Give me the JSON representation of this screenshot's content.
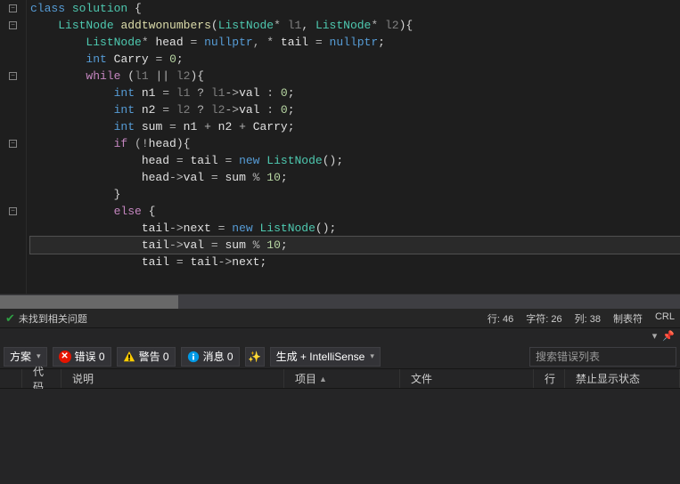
{
  "code": {
    "lines": [
      {
        "fold": "-",
        "segs": [
          {
            "t": "class ",
            "c": "kw"
          },
          {
            "t": "solution",
            "c": "type"
          },
          {
            "t": " {",
            "c": "punct"
          }
        ]
      },
      {
        "fold": "-",
        "segs": [
          {
            "t": "    ",
            "c": ""
          },
          {
            "t": "ListNode",
            "c": "type"
          },
          {
            "t": " ",
            "c": ""
          },
          {
            "t": "addtwonumbers",
            "c": "fn"
          },
          {
            "t": "(",
            "c": "punct"
          },
          {
            "t": "ListNode",
            "c": "type"
          },
          {
            "t": "* ",
            "c": "op"
          },
          {
            "t": "l1",
            "c": "param"
          },
          {
            "t": ", ",
            "c": "punct"
          },
          {
            "t": "ListNode",
            "c": "type"
          },
          {
            "t": "* ",
            "c": "op"
          },
          {
            "t": "l2",
            "c": "param"
          },
          {
            "t": "){",
            "c": "punct"
          }
        ]
      },
      {
        "fold": "",
        "segs": [
          {
            "t": "        ",
            "c": ""
          },
          {
            "t": "ListNode",
            "c": "type"
          },
          {
            "t": "* ",
            "c": "op"
          },
          {
            "t": "head",
            "c": "var"
          },
          {
            "t": " = ",
            "c": "op"
          },
          {
            "t": "nullptr",
            "c": "np"
          },
          {
            "t": ", * ",
            "c": "op"
          },
          {
            "t": "tail",
            "c": "var"
          },
          {
            "t": " = ",
            "c": "op"
          },
          {
            "t": "nullptr",
            "c": "np"
          },
          {
            "t": ";",
            "c": "punct"
          }
        ]
      },
      {
        "fold": "",
        "segs": [
          {
            "t": "        ",
            "c": ""
          },
          {
            "t": "int",
            "c": "kw"
          },
          {
            "t": " ",
            "c": ""
          },
          {
            "t": "Carry",
            "c": "var"
          },
          {
            "t": " = ",
            "c": "op"
          },
          {
            "t": "0",
            "c": "num"
          },
          {
            "t": ";",
            "c": "punct"
          }
        ]
      },
      {
        "fold": "-",
        "segs": [
          {
            "t": "        ",
            "c": ""
          },
          {
            "t": "while",
            "c": "newk"
          },
          {
            "t": " (",
            "c": "punct"
          },
          {
            "t": "l1",
            "c": "param"
          },
          {
            "t": " || ",
            "c": "op"
          },
          {
            "t": "l2",
            "c": "param"
          },
          {
            "t": "){",
            "c": "punct"
          }
        ]
      },
      {
        "fold": "",
        "segs": [
          {
            "t": "            ",
            "c": ""
          },
          {
            "t": "int",
            "c": "kw"
          },
          {
            "t": " ",
            "c": ""
          },
          {
            "t": "n1",
            "c": "var"
          },
          {
            "t": " = ",
            "c": "op"
          },
          {
            "t": "l1",
            "c": "param"
          },
          {
            "t": " ? ",
            "c": "op"
          },
          {
            "t": "l1",
            "c": "param"
          },
          {
            "t": "->",
            "c": "op"
          },
          {
            "t": "val",
            "c": "var"
          },
          {
            "t": " : ",
            "c": "op"
          },
          {
            "t": "0",
            "c": "num"
          },
          {
            "t": ";",
            "c": "punct"
          }
        ]
      },
      {
        "fold": "",
        "segs": [
          {
            "t": "            ",
            "c": ""
          },
          {
            "t": "int",
            "c": "kw"
          },
          {
            "t": " ",
            "c": ""
          },
          {
            "t": "n2",
            "c": "var"
          },
          {
            "t": " = ",
            "c": "op"
          },
          {
            "t": "l2",
            "c": "param"
          },
          {
            "t": " ? ",
            "c": "op"
          },
          {
            "t": "l2",
            "c": "param"
          },
          {
            "t": "->",
            "c": "op"
          },
          {
            "t": "val",
            "c": "var"
          },
          {
            "t": " : ",
            "c": "op"
          },
          {
            "t": "0",
            "c": "num"
          },
          {
            "t": ";",
            "c": "punct"
          }
        ]
      },
      {
        "fold": "",
        "segs": [
          {
            "t": "            ",
            "c": ""
          },
          {
            "t": "int",
            "c": "kw"
          },
          {
            "t": " ",
            "c": ""
          },
          {
            "t": "sum",
            "c": "var"
          },
          {
            "t": " = ",
            "c": "op"
          },
          {
            "t": "n1",
            "c": "var"
          },
          {
            "t": " + ",
            "c": "op"
          },
          {
            "t": "n2",
            "c": "var"
          },
          {
            "t": " + ",
            "c": "op"
          },
          {
            "t": "Carry",
            "c": "var"
          },
          {
            "t": ";",
            "c": "punct"
          }
        ]
      },
      {
        "fold": "-",
        "segs": [
          {
            "t": "            ",
            "c": ""
          },
          {
            "t": "if",
            "c": "newk"
          },
          {
            "t": " (!",
            "c": "op"
          },
          {
            "t": "head",
            "c": "var"
          },
          {
            "t": "){",
            "c": "punct"
          }
        ]
      },
      {
        "fold": "",
        "segs": [
          {
            "t": "                ",
            "c": ""
          },
          {
            "t": "head",
            "c": "var"
          },
          {
            "t": " = ",
            "c": "op"
          },
          {
            "t": "tail",
            "c": "var"
          },
          {
            "t": " = ",
            "c": "op"
          },
          {
            "t": "new",
            "c": "kw"
          },
          {
            "t": " ",
            "c": ""
          },
          {
            "t": "ListNode",
            "c": "type"
          },
          {
            "t": "();",
            "c": "punct"
          }
        ]
      },
      {
        "fold": "",
        "segs": [
          {
            "t": "                ",
            "c": ""
          },
          {
            "t": "head",
            "c": "var"
          },
          {
            "t": "->",
            "c": "op"
          },
          {
            "t": "val",
            "c": "var"
          },
          {
            "t": " = ",
            "c": "op"
          },
          {
            "t": "sum",
            "c": "var"
          },
          {
            "t": " % ",
            "c": "op"
          },
          {
            "t": "10",
            "c": "num"
          },
          {
            "t": ";",
            "c": "punct"
          }
        ]
      },
      {
        "fold": "",
        "segs": [
          {
            "t": "            }",
            "c": "punct"
          }
        ]
      },
      {
        "fold": "-",
        "segs": [
          {
            "t": "            ",
            "c": ""
          },
          {
            "t": "else",
            "c": "newk"
          },
          {
            "t": " {",
            "c": "punct"
          }
        ]
      },
      {
        "fold": "",
        "segs": [
          {
            "t": "                ",
            "c": ""
          },
          {
            "t": "tail",
            "c": "var"
          },
          {
            "t": "->",
            "c": "op"
          },
          {
            "t": "next",
            "c": "var"
          },
          {
            "t": " = ",
            "c": "op"
          },
          {
            "t": "new",
            "c": "kw"
          },
          {
            "t": " ",
            "c": ""
          },
          {
            "t": "ListNode",
            "c": "type"
          },
          {
            "t": "();",
            "c": "punct"
          }
        ]
      },
      {
        "fold": "",
        "hl": true,
        "segs": [
          {
            "t": "                ",
            "c": ""
          },
          {
            "t": "tail",
            "c": "var"
          },
          {
            "t": "->",
            "c": "op"
          },
          {
            "t": "val",
            "c": "var"
          },
          {
            "t": " = ",
            "c": "op"
          },
          {
            "t": "sum",
            "c": "var"
          },
          {
            "t": " % ",
            "c": "op"
          },
          {
            "t": "10",
            "c": "num"
          },
          {
            "t": ";",
            "c": "punct"
          }
        ]
      },
      {
        "fold": "",
        "segs": [
          {
            "t": "                ",
            "c": ""
          },
          {
            "t": "tail",
            "c": "var"
          },
          {
            "t": " = ",
            "c": "op"
          },
          {
            "t": "tail",
            "c": "var"
          },
          {
            "t": "->",
            "c": "op"
          },
          {
            "t": "next",
            "c": "var"
          },
          {
            "t": ";",
            "c": "punct"
          }
        ]
      },
      {
        "fold": "",
        "segs": [
          {
            "t": " ",
            "c": ""
          }
        ]
      }
    ]
  },
  "status": {
    "issues": "未找到相关问题",
    "line": "行: 46",
    "char": "字符: 26",
    "col": "列: 38",
    "tabs": "制表符",
    "crlf": "CRL"
  },
  "toolbar": {
    "solution": "方案",
    "errors": "错误 0",
    "warnings": "警告 0",
    "messages": "消息 0",
    "build": "生成 + IntelliSense",
    "search_placeholder": "搜索错误列表"
  },
  "headers": {
    "code": "代码",
    "desc": "说明",
    "project": "项目",
    "file": "文件",
    "line": "行",
    "suppress": "禁止显示状态"
  }
}
